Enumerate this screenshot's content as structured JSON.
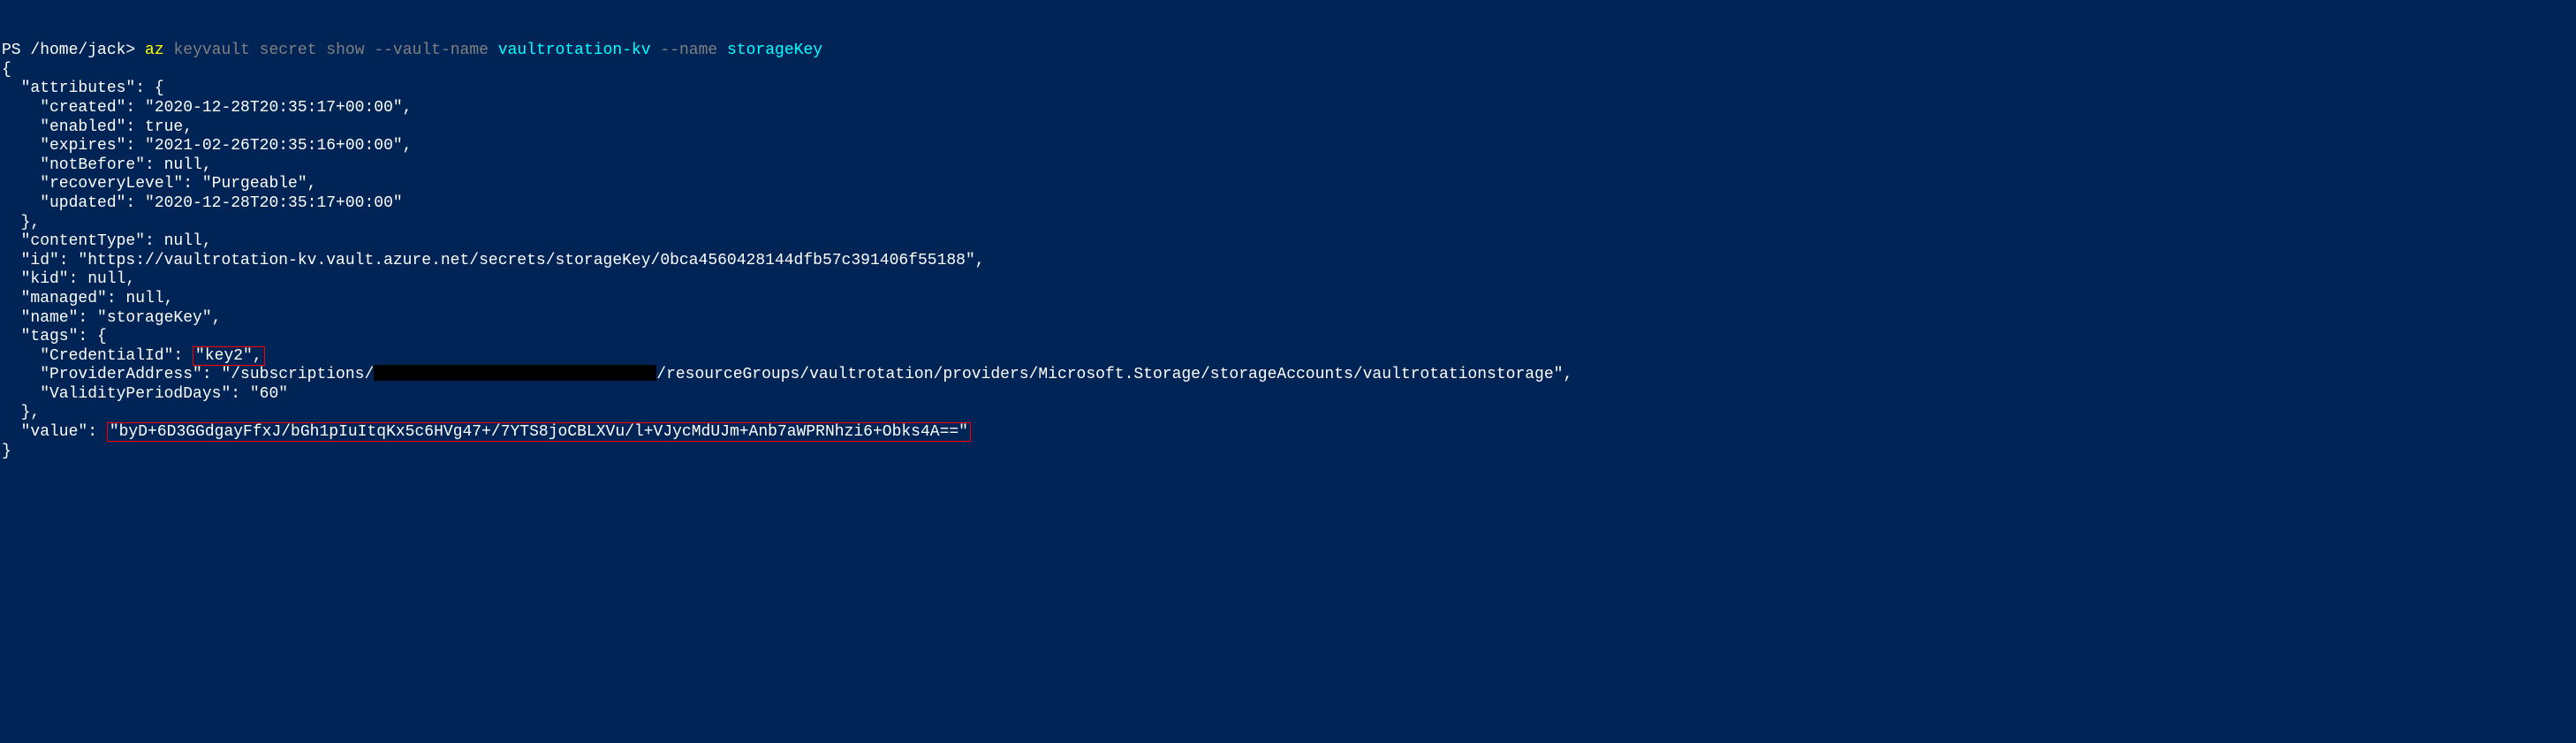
{
  "prompt": {
    "prefix": "PS /home/jack>",
    "command": "az",
    "subcommand": "keyvault secret show",
    "flag1": "--vault-name",
    "arg1": "vaultrotation-kv",
    "flag2": "--name",
    "arg2": "storageKey"
  },
  "output": {
    "open_brace": "{",
    "attributes_key": "  \"attributes\": {",
    "created": "    \"created\": \"2020-12-28T20:35:17+00:00\",",
    "enabled": "    \"enabled\": true,",
    "expires": "    \"expires\": \"2021-02-26T20:35:16+00:00\",",
    "notBefore": "    \"notBefore\": null,",
    "recoveryLevel": "    \"recoveryLevel\": \"Purgeable\",",
    "updated": "    \"updated\": \"2020-12-28T20:35:17+00:00\"",
    "attributes_close": "  },",
    "contentType": "  \"contentType\": null,",
    "id": "  \"id\": \"https://vaultrotation-kv.vault.azure.net/secrets/storageKey/0bca4560428144dfb57c391406f55188\",",
    "kid": "  \"kid\": null,",
    "managed": "  \"managed\": null,",
    "name": "  \"name\": \"storageKey\",",
    "tags_key": "  \"tags\": {",
    "credentialId_pre": "    \"CredentialId\": ",
    "credentialId_val": "\"key2\",",
    "providerAddress_pre": "    \"ProviderAddress\": \"/subscriptions/",
    "providerAddress_post": "/resourceGroups/vaultrotation/providers/Microsoft.Storage/storageAccounts/vaultrotationstorage\",",
    "validityPeriodDays": "    \"ValidityPeriodDays\": \"60\"",
    "tags_close": "  },",
    "value_pre": "  \"value\": ",
    "value_val": "\"byD+6D3GGdgayFfxJ/bGh1pIuItqKx5c6HVg47+/7YTS8joCBLXVu/l+VJycMdUJm+Anb7aWPRNhzi6+Obks4A==\"",
    "close_brace": "}"
  }
}
